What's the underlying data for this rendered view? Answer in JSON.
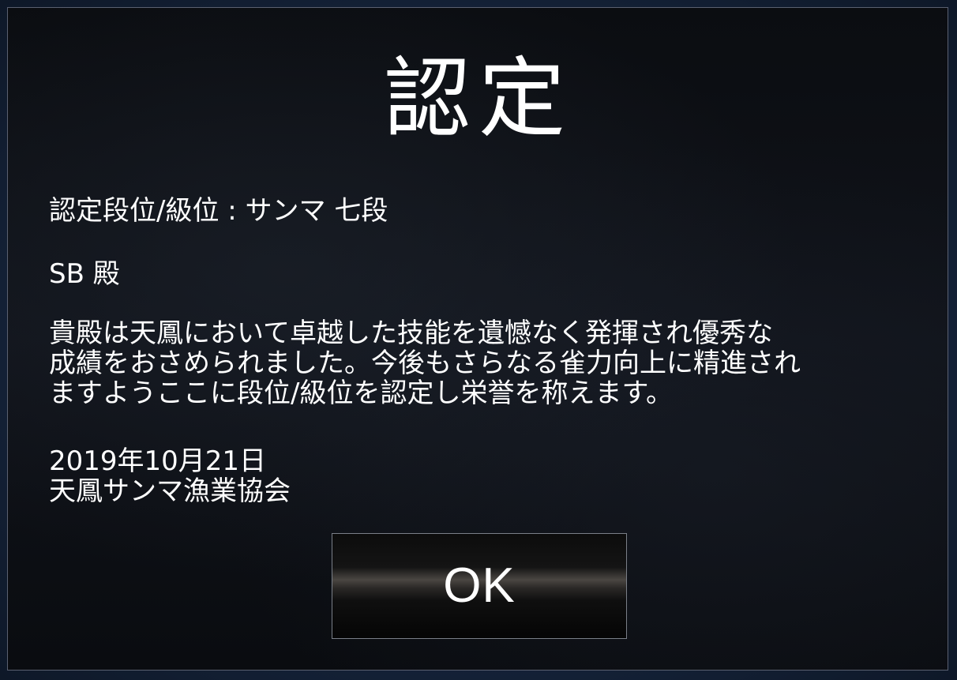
{
  "dialog": {
    "title": "認定",
    "rank_line": "認定段位/級位 : サンマ 七段",
    "recipient_line": "SB 殿",
    "message_lines": [
      "貴殿は天鳳において卓越した技能を遺憾なく発揮され優秀な",
      "成績をおさめられました。今後もさらなる雀力向上に精進され",
      "ますようここに段位/級位を認定し栄誉を称えます。"
    ],
    "date": "2019年10月21日",
    "organization": "天鳳サンマ漁業協会",
    "ok_label": "OK"
  },
  "colors": {
    "text": "#ffffff",
    "dialog_background": "#0d0f14",
    "page_background": "#1a2a44",
    "border": "#5a6070"
  }
}
